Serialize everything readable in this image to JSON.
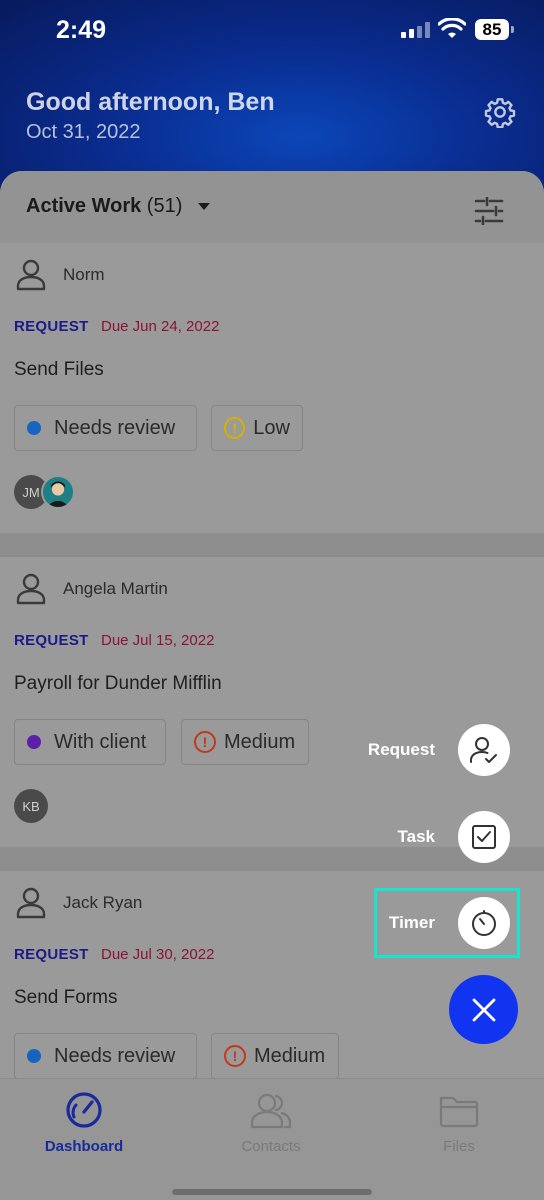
{
  "status_bar": {
    "time": "2:49",
    "battery": "85"
  },
  "header": {
    "greeting": "Good afternoon, Ben",
    "date": "Oct 31, 2022",
    "settings_icon": "gear-icon"
  },
  "list_header": {
    "label": "Active Work",
    "count": "(51)",
    "filter_icon": "sliders-icon"
  },
  "cards": [
    {
      "name": "Norm",
      "type": "REQUEST",
      "due": "Due Jun 24, 2022",
      "title": "Send Files",
      "status": "Needs review",
      "status_color": "#1565c0",
      "priority": "Low",
      "priority_color": "#d4b200",
      "avatars": [
        "JM",
        ""
      ]
    },
    {
      "name": "Angela Martin",
      "type": "REQUEST",
      "due": "Due Jul 15, 2022",
      "title": "Payroll for Dunder Mifflin",
      "status": "With client",
      "status_color": "#5b1fa8",
      "priority": "Medium",
      "priority_color": "#c0391b",
      "avatars": [
        "KB"
      ]
    },
    {
      "name": "Jack Ryan",
      "type": "REQUEST",
      "due": "Due Jul 30, 2022",
      "title": "Send Forms",
      "status": "Needs review",
      "status_color": "#1565c0",
      "priority": "Medium",
      "priority_color": "#c0391b",
      "avatars": []
    }
  ],
  "fab_menu": {
    "request": "Request",
    "task": "Task",
    "timer": "Timer",
    "highlight_color": "#17e5cf",
    "main_color": "#1034f0"
  },
  "tabs": [
    {
      "label": "Dashboard",
      "icon": "speedometer-icon",
      "active": true
    },
    {
      "label": "Contacts",
      "icon": "contacts-icon",
      "active": false
    },
    {
      "label": "Files",
      "icon": "folder-icon",
      "active": false
    }
  ]
}
